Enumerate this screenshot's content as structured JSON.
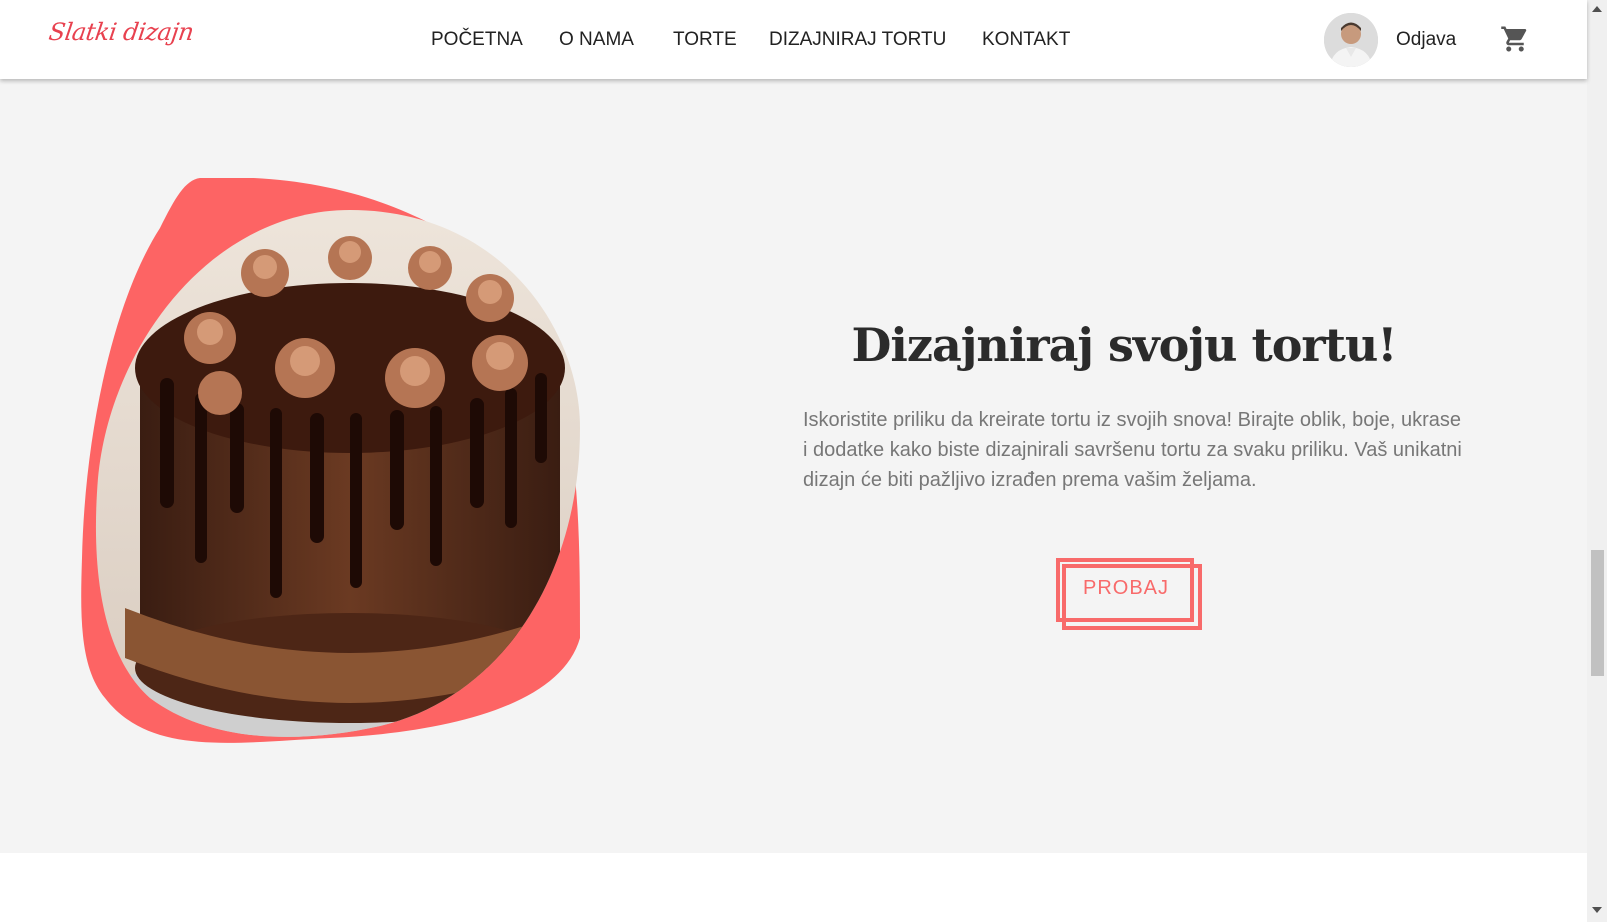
{
  "nav": {
    "logo": "Slatki dizajn",
    "links": [
      {
        "label": "POČETNA"
      },
      {
        "label": "O NAMA"
      },
      {
        "label": "TORTE"
      },
      {
        "label": "DIZAJNIRAJ TORTU"
      },
      {
        "label": "KONTAKT"
      }
    ],
    "logout_label": "Odjava",
    "avatar_icon": "user-avatar",
    "cart_icon": "cart-icon"
  },
  "hero": {
    "title": "Dizajniraj svoju tortu!",
    "description": "Iskoristite priliku da kreirate tortu iz svojih snova! Birajte oblik, boje, ukrase i dodatke kako biste dizajnirali savršenu tortu za svaku priliku. Vaš unikatni dizajn će biti pažljivo izrađen prema vašim željama.",
    "cta_label": "PROBAJ",
    "image_icon": "chocolate-cake-image"
  },
  "colors": {
    "accent": "#f86a6a",
    "logo": "#e8414f",
    "hero_bg": "#f4f4f4",
    "text_dark": "#2b2b2b",
    "text_muted": "#777777"
  }
}
